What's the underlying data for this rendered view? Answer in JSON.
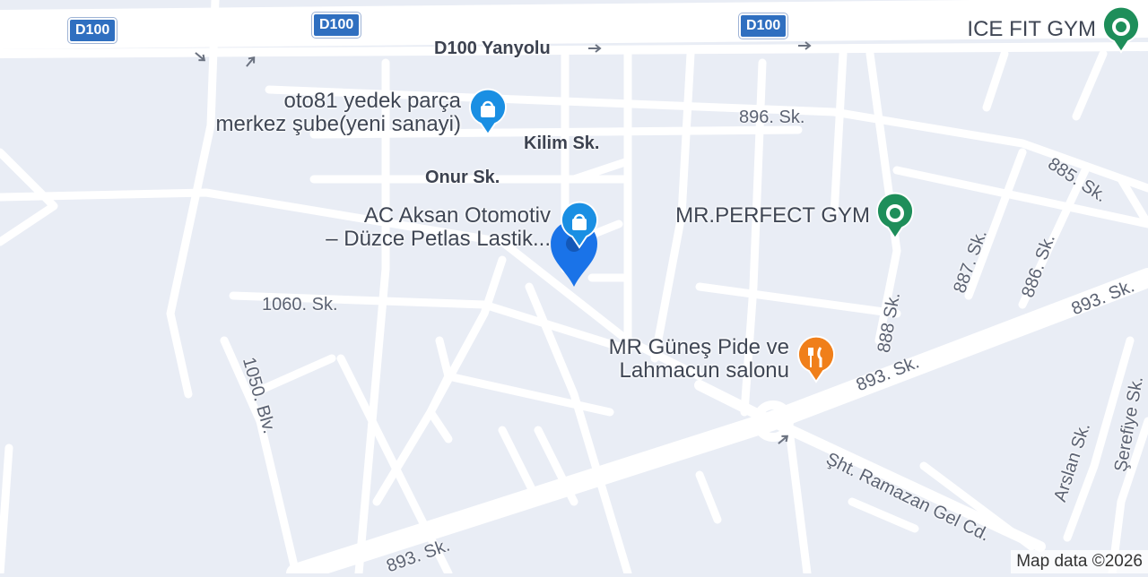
{
  "map": {
    "route_shields": [
      "D100",
      "D100",
      "D100"
    ],
    "streets": {
      "d100_yanyolu": "D100 Yanyolu",
      "kilim": "Kilim Sk.",
      "onur": "Onur Sk.",
      "sk_896": "896. Sk.",
      "sk_885": "885. Sk.",
      "sk_887": "887. Sk.",
      "sk_886": "886. Sk.",
      "sk_888": "888 Sk.",
      "sk_893_a": "893. Sk.",
      "sk_893_b": "893. Sk.",
      "sk_893_c": "893. Sk.",
      "sk_1060": "1060. Sk.",
      "blv_1050": "1050. Blv.",
      "ramazan": "Şht. Ramazan Gel Cd.",
      "arslan": "Arslan Sk.",
      "serefiye": "Şerefiye Sk."
    },
    "pois": [
      {
        "name_line1": "ICE FIT GYM",
        "name_line2": "",
        "type": "gym",
        "icon": "dumbbell-icon",
        "color": "#1e8e5a"
      },
      {
        "name_line1": "oto81 yedek parça",
        "name_line2": "merkez şube(yeni sanayi)",
        "type": "shop",
        "icon": "shopping-bag-icon",
        "color": "#1a8fe3"
      },
      {
        "name_line1": "AC Aksan Otomotiv",
        "name_line2": "– Düzce Petlas Lastik...",
        "type": "shop",
        "icon": "shopping-bag-icon",
        "color": "#1a8fe3"
      },
      {
        "name_line1": "MR.PERFECT GYM",
        "name_line2": "",
        "type": "gym",
        "icon": "dumbbell-icon",
        "color": "#1e8e5a"
      },
      {
        "name_line1": "MR Güneş Pide ve",
        "name_line2": "Lahmacun salonu",
        "type": "restaurant",
        "icon": "fork-knife-icon",
        "color": "#f07f1a"
      }
    ],
    "selected_pin": {
      "color": "#1a73e8",
      "icon": "location-pin-icon"
    },
    "attribution": "Map data ©2026"
  }
}
